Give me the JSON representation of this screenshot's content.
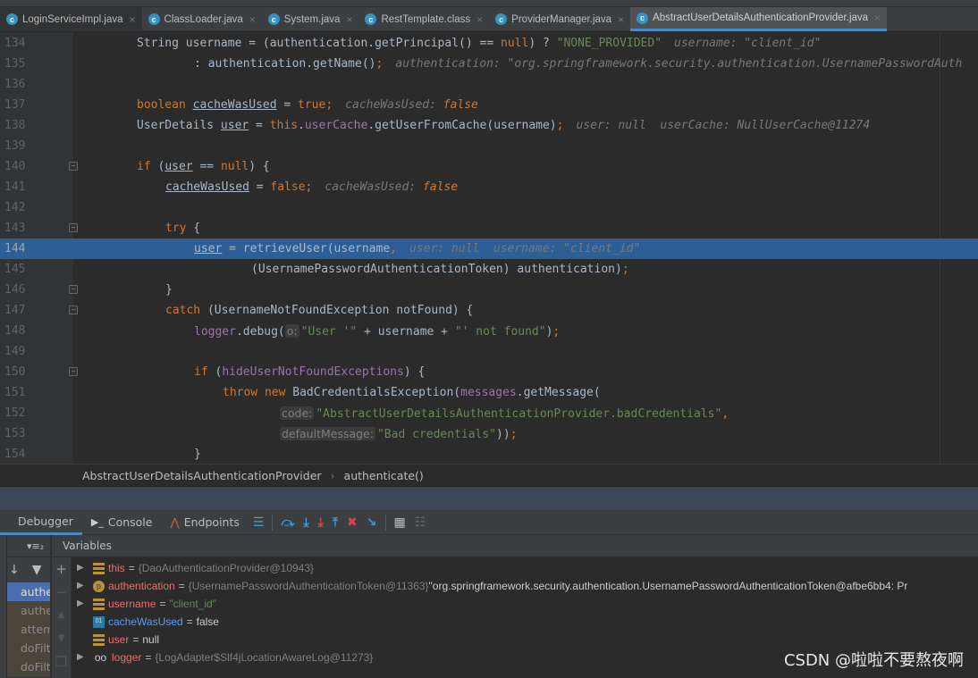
{
  "tabs": [
    {
      "label": "LoginServiceImpl.java",
      "icon": "class-icon"
    },
    {
      "label": "ClassLoader.java",
      "icon": "class-locked-icon"
    },
    {
      "label": "System.java",
      "icon": "class-locked-icon"
    },
    {
      "label": "RestTemplate.class",
      "icon": "class-locked-icon"
    },
    {
      "label": "ProviderManager.java",
      "icon": "class-locked-icon"
    },
    {
      "label": "AbstractUserDetailsAuthenticationProvider.java",
      "icon": "class-locked-icon",
      "active": true
    }
  ],
  "editor": {
    "highlighted_line": "144",
    "lines": [
      {
        "n": "134",
        "indent": 8,
        "tokens": [
          [
            "plain",
            "String username = (authentication.getPrincipal() == "
          ],
          [
            "kw",
            "null"
          ],
          [
            "plain",
            ") ? "
          ],
          [
            "str",
            "\"NONE_PROVIDED\""
          ],
          [
            "hint",
            "username: \"client_id\""
          ]
        ]
      },
      {
        "n": "135",
        "indent": 16,
        "tokens": [
          [
            "plain",
            ": authentication.getName()"
          ],
          [
            "kw",
            ";"
          ],
          [
            "hint",
            "authentication: \"org.springframework.security.authentication.UsernamePasswordAuth"
          ]
        ]
      },
      {
        "n": "136",
        "indent": 0,
        "tokens": []
      },
      {
        "n": "137",
        "indent": 8,
        "tokens": [
          [
            "kw",
            "boolean "
          ],
          [
            "ul",
            "cacheWasUsed"
          ],
          [
            "plain",
            " = "
          ],
          [
            "kw",
            "true;"
          ],
          [
            "hint",
            "cacheWasUsed: "
          ],
          [
            "hintkw",
            "false"
          ]
        ]
      },
      {
        "n": "138",
        "indent": 8,
        "tokens": [
          [
            "plain",
            "UserDetails "
          ],
          [
            "ul",
            "user"
          ],
          [
            "plain",
            " = "
          ],
          [
            "kw",
            "this"
          ],
          [
            "plain",
            "."
          ],
          [
            "field",
            "userCache"
          ],
          [
            "plain",
            ".getUserFromCache(username)"
          ],
          [
            "kw",
            ";"
          ],
          [
            "hint",
            "user: null  userCache: NullUserCache@11274"
          ]
        ]
      },
      {
        "n": "139",
        "indent": 0,
        "tokens": []
      },
      {
        "n": "140",
        "indent": 8,
        "fold": true,
        "tokens": [
          [
            "kw",
            "if"
          ],
          [
            "plain",
            " ("
          ],
          [
            "ul",
            "user"
          ],
          [
            "plain",
            " == "
          ],
          [
            "kw",
            "null"
          ],
          [
            "plain",
            ") {"
          ]
        ]
      },
      {
        "n": "141",
        "indent": 12,
        "tokens": [
          [
            "ul",
            "cacheWasUsed"
          ],
          [
            "plain",
            " = "
          ],
          [
            "kw",
            "false;"
          ],
          [
            "hint",
            "cacheWasUsed: "
          ],
          [
            "hintkw",
            "false"
          ]
        ]
      },
      {
        "n": "142",
        "indent": 0,
        "tokens": []
      },
      {
        "n": "143",
        "indent": 12,
        "fold": true,
        "tokens": [
          [
            "kw",
            "try"
          ],
          [
            "plain",
            " {"
          ]
        ]
      },
      {
        "n": "144",
        "indent": 16,
        "tokens": [
          [
            "ul",
            "user"
          ],
          [
            "plain",
            " = retrieveUser(username"
          ],
          [
            "kw",
            ","
          ],
          [
            "hint",
            "user: null  username: \"client_id\""
          ]
        ]
      },
      {
        "n": "145",
        "indent": 24,
        "tokens": [
          [
            "plain",
            "(UsernamePasswordAuthenticationToken) authentication)"
          ],
          [
            "kw",
            ";"
          ]
        ]
      },
      {
        "n": "146",
        "indent": 12,
        "fold": true,
        "tokens": [
          [
            "plain",
            "}"
          ]
        ]
      },
      {
        "n": "147",
        "indent": 12,
        "fold": true,
        "tokens": [
          [
            "kw",
            "catch"
          ],
          [
            "plain",
            " (UsernameNotFoundException notFound) {"
          ]
        ]
      },
      {
        "n": "148",
        "indent": 16,
        "tokens": [
          [
            "field",
            "logger"
          ],
          [
            "plain",
            ".debug("
          ],
          [
            "param",
            "o:"
          ],
          [
            "str",
            "\"User '\""
          ],
          [
            "plain",
            " + username + "
          ],
          [
            "str",
            "\"' not found\""
          ],
          [
            "plain",
            ")"
          ],
          [
            "kw",
            ";"
          ]
        ]
      },
      {
        "n": "149",
        "indent": 0,
        "tokens": []
      },
      {
        "n": "150",
        "indent": 16,
        "fold": true,
        "tokens": [
          [
            "kw",
            "if"
          ],
          [
            "plain",
            " ("
          ],
          [
            "field",
            "hideUserNotFoundExceptions"
          ],
          [
            "plain",
            ") {"
          ]
        ]
      },
      {
        "n": "151",
        "indent": 20,
        "tokens": [
          [
            "kw",
            "throw new "
          ],
          [
            "plain",
            "BadCredentialsException("
          ],
          [
            "field",
            "messages"
          ],
          [
            "plain",
            ".getMessage("
          ]
        ]
      },
      {
        "n": "152",
        "indent": 28,
        "tokens": [
          [
            "param",
            "code:"
          ],
          [
            "str",
            "\"AbstractUserDetailsAuthenticationProvider.badCredentials\""
          ],
          [
            "kw",
            ","
          ]
        ]
      },
      {
        "n": "153",
        "indent": 28,
        "tokens": [
          [
            "param",
            "defaultMessage:"
          ],
          [
            "str",
            "\"Bad credentials\""
          ],
          [
            "plain",
            "))"
          ],
          [
            "kw",
            ";"
          ]
        ]
      },
      {
        "n": "154",
        "indent": 16,
        "tokens": [
          [
            "plain",
            "}"
          ]
        ]
      }
    ]
  },
  "breadcrumb": {
    "class": "AbstractUserDetailsAuthenticationProvider",
    "method": "authenticate()"
  },
  "debugger": {
    "tabs": {
      "debugger": "Debugger",
      "console": "Console",
      "endpoints": "Endpoints"
    },
    "frames_header": "▾≡₂",
    "frames": [
      "authe",
      "authe",
      "attem",
      "doFilt",
      "doFilt"
    ],
    "variables_header": "Variables",
    "variables": [
      {
        "name": "this",
        "value": "{DaoAuthenticationProvider@10943}",
        "kind": "obj",
        "icon": "field",
        "expandable": true
      },
      {
        "name": "authentication",
        "value": "{UsernamePasswordAuthenticationToken@11363}",
        "extra": " \"org.springframework.security.authentication.UsernamePasswordAuthenticationToken@afbe6bb4: Pr",
        "kind": "obj",
        "icon": "param",
        "expandable": true
      },
      {
        "name": "username",
        "value": "\"client_id\"",
        "kind": "str",
        "icon": "field",
        "expandable": true
      },
      {
        "name": "cacheWasUsed",
        "value": "false",
        "kind": "plain",
        "icon": "primitive",
        "expandable": false
      },
      {
        "name": "user",
        "value": "null",
        "kind": "plain",
        "icon": "field",
        "expandable": false
      },
      {
        "name": "logger",
        "value": "{LogAdapter$Slf4jLocationAwareLog@11273}",
        "kind": "obj",
        "icon": "watch",
        "expandable": true
      }
    ]
  },
  "watermark": "CSDN @啦啦不要熬夜啊",
  "colors": {
    "keyword": "#cc7832",
    "string": "#6a8759",
    "field": "#9876aa",
    "highlight": "#2d5f96",
    "accent": "#4a88c7"
  }
}
